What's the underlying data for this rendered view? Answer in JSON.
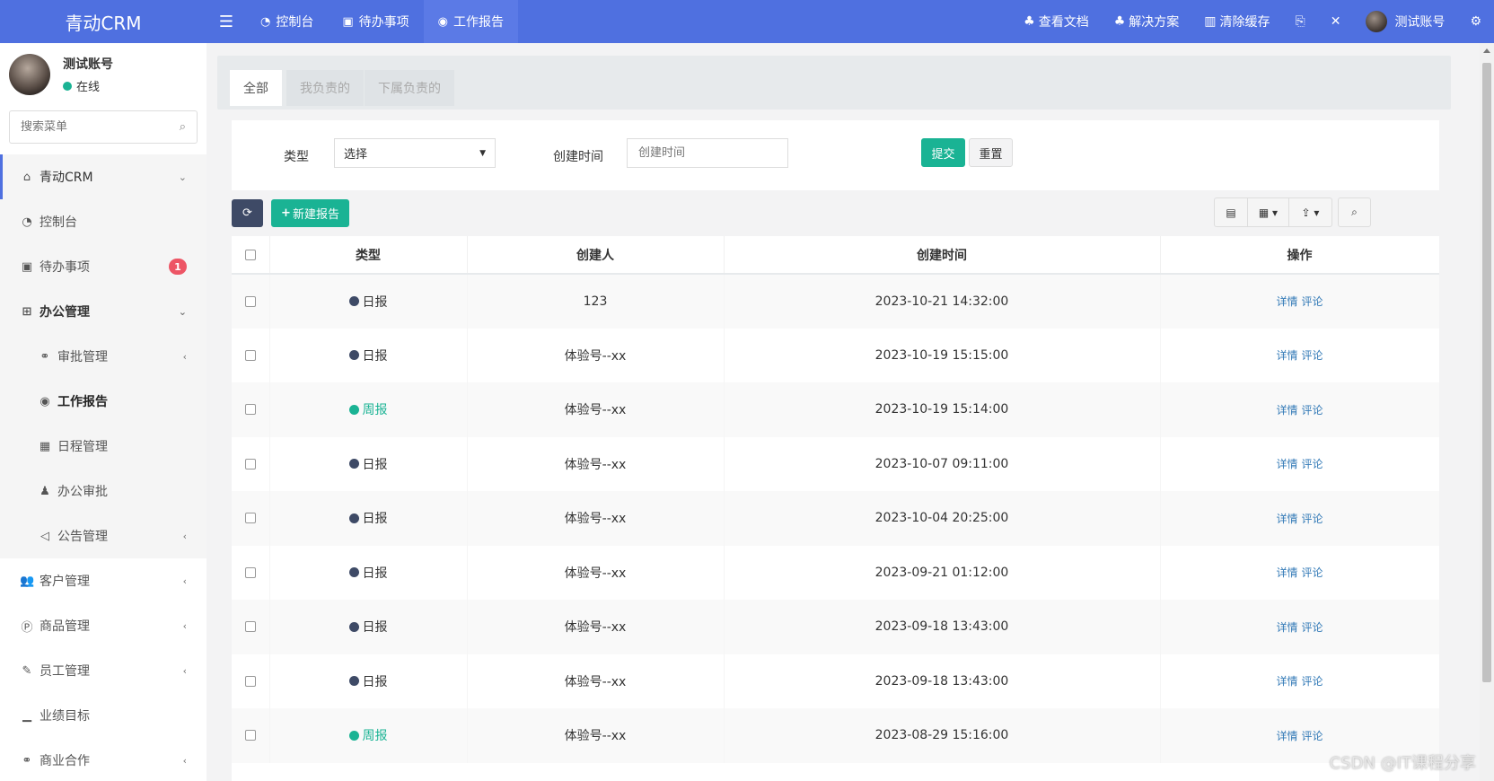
{
  "brand": {
    "title": "青动CRM"
  },
  "topnav": {
    "tabs": [
      {
        "label": "控制台",
        "icon": "dashboard-icon"
      },
      {
        "label": "待办事项",
        "icon": "calendar-check-icon"
      },
      {
        "label": "工作报告",
        "icon": "report-icon"
      }
    ],
    "links": [
      {
        "label": "查看文档"
      },
      {
        "label": "解决方案"
      },
      {
        "label": "清除缓存"
      }
    ],
    "user": "测试账号"
  },
  "sidebar": {
    "user_name": "测试账号",
    "status": "在线",
    "search_placeholder": "搜索菜单",
    "items": [
      {
        "label": "青动CRM"
      },
      {
        "label": "控制台"
      },
      {
        "label": "待办事项",
        "badge": "1"
      },
      {
        "label": "办公管理"
      },
      {
        "label": "审批管理"
      },
      {
        "label": "工作报告"
      },
      {
        "label": "日程管理"
      },
      {
        "label": "办公审批"
      },
      {
        "label": "公告管理"
      },
      {
        "label": "客户管理"
      },
      {
        "label": "商品管理"
      },
      {
        "label": "员工管理"
      },
      {
        "label": "业绩目标"
      },
      {
        "label": "商业合作"
      }
    ]
  },
  "tabs": [
    {
      "label": "全部"
    },
    {
      "label": "我负责的"
    },
    {
      "label": "下属负责的"
    }
  ],
  "filter": {
    "type_label": "类型",
    "type_value": "选择",
    "created_label": "创建时间",
    "created_placeholder": "创建时间",
    "submit_label": "提交",
    "reset_label": "重置"
  },
  "toolbar": {
    "new_label": "新建报告"
  },
  "table": {
    "headers": [
      "类型",
      "创建人",
      "创建时间",
      "操作"
    ],
    "ops": [
      "详情",
      "评论"
    ],
    "rows": [
      {
        "type": "日报",
        "creator": "123",
        "time": "2023-10-21 14:32:00"
      },
      {
        "type": "日报",
        "creator": "体验号--xx",
        "time": "2023-10-19 15:15:00"
      },
      {
        "type": "周报",
        "creator": "体验号--xx",
        "time": "2023-10-19 15:14:00"
      },
      {
        "type": "日报",
        "creator": "体验号--xx",
        "time": "2023-10-07 09:11:00"
      },
      {
        "type": "日报",
        "creator": "体验号--xx",
        "time": "2023-10-04 20:25:00"
      },
      {
        "type": "日报",
        "creator": "体验号--xx",
        "time": "2023-09-21 01:12:00"
      },
      {
        "type": "日报",
        "creator": "体验号--xx",
        "time": "2023-09-18 13:43:00"
      },
      {
        "type": "日报",
        "creator": "体验号--xx",
        "time": "2023-09-18 13:43:00"
      },
      {
        "type": "周报",
        "creator": "体验号--xx",
        "time": "2023-08-29 15:16:00"
      }
    ]
  },
  "colors": {
    "daily": "#3e4a66",
    "weekly": "#1ab394",
    "weekly_text": "#1ab394"
  },
  "watermark": "CSDN @IT课程分享"
}
